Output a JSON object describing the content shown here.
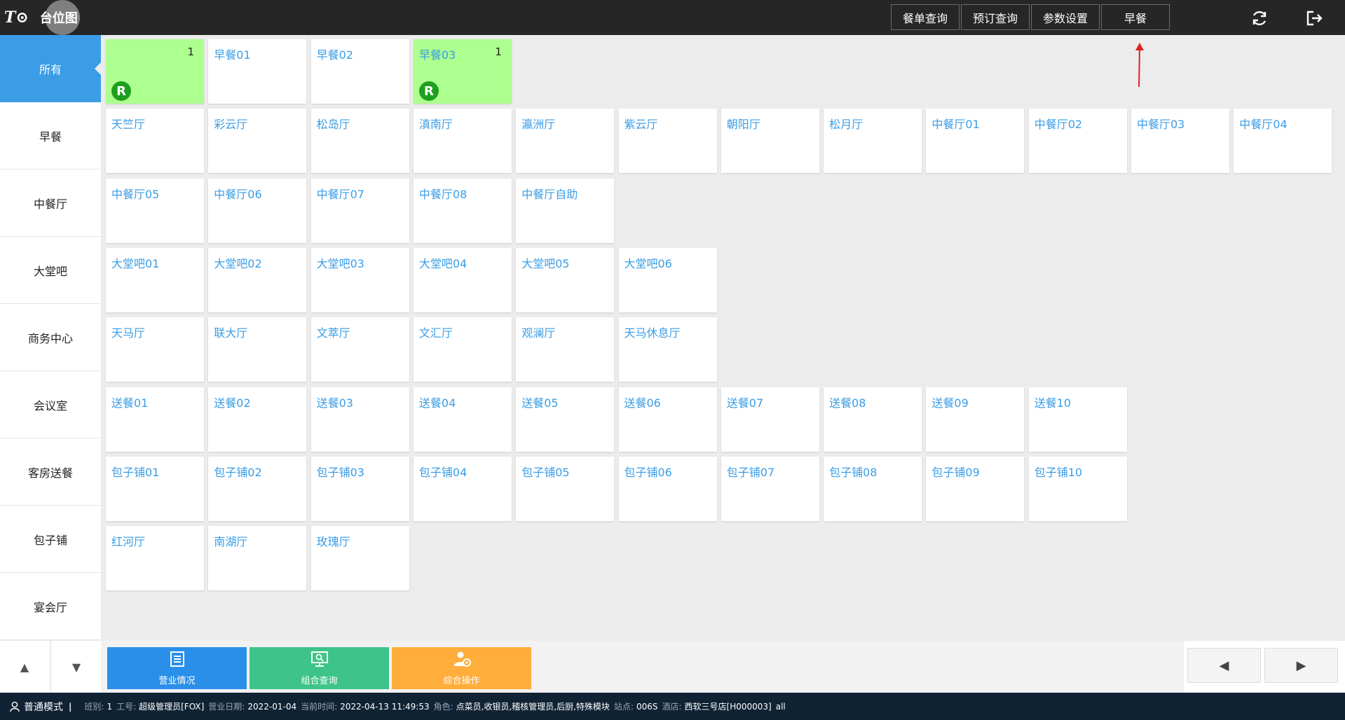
{
  "app": {
    "title": "台位图"
  },
  "header": {
    "buttons": [
      {
        "label": "餐单查询"
      },
      {
        "label": "预订查询"
      },
      {
        "label": "参数设置"
      },
      {
        "label": "早餐"
      }
    ],
    "refresh_icon": "refresh-icon",
    "logout_icon": "logout-icon"
  },
  "sidebar": {
    "items": [
      {
        "label": "所有",
        "active": true
      },
      {
        "label": "早餐"
      },
      {
        "label": "中餐厅"
      },
      {
        "label": "大堂吧"
      },
      {
        "label": "商务中心"
      },
      {
        "label": "会议室"
      },
      {
        "label": "客房送餐"
      },
      {
        "label": "包子铺"
      },
      {
        "label": "宴会厅"
      }
    ]
  },
  "tables": [
    [
      {
        "name": "",
        "occupied": true,
        "count": "1",
        "badge": "R"
      },
      {
        "name": "早餐01"
      },
      {
        "name": "早餐02"
      },
      {
        "name": "早餐03",
        "occupied": true,
        "count": "1",
        "badge": "R"
      }
    ],
    [
      {
        "name": "天竺厅"
      },
      {
        "name": "彩云厅"
      },
      {
        "name": "松岛厅"
      },
      {
        "name": "滇南厅"
      },
      {
        "name": "瀛洲厅"
      },
      {
        "name": "紫云厅"
      },
      {
        "name": "朝阳厅"
      },
      {
        "name": "松月厅"
      },
      {
        "name": "中餐厅01"
      },
      {
        "name": "中餐厅02"
      },
      {
        "name": "中餐厅03"
      },
      {
        "name": "中餐厅04"
      }
    ],
    [
      {
        "name": "中餐厅05"
      },
      {
        "name": "中餐厅06"
      },
      {
        "name": "中餐厅07"
      },
      {
        "name": "中餐厅08"
      },
      {
        "name": "中餐厅自助"
      }
    ],
    [
      {
        "name": "大堂吧01"
      },
      {
        "name": "大堂吧02"
      },
      {
        "name": "大堂吧03"
      },
      {
        "name": "大堂吧04"
      },
      {
        "name": "大堂吧05"
      },
      {
        "name": "大堂吧06"
      }
    ],
    [
      {
        "name": "天马厅"
      },
      {
        "name": "联大厅"
      },
      {
        "name": "文萃厅"
      },
      {
        "name": "文汇厅"
      },
      {
        "name": "观澜厅"
      },
      {
        "name": "天马休息厅"
      }
    ],
    [
      {
        "name": "送餐01"
      },
      {
        "name": "送餐02"
      },
      {
        "name": "送餐03"
      },
      {
        "name": "送餐04"
      },
      {
        "name": "送餐05"
      },
      {
        "name": "送餐06"
      },
      {
        "name": "送餐07"
      },
      {
        "name": "送餐08"
      },
      {
        "name": "送餐09"
      },
      {
        "name": "送餐10"
      }
    ],
    [
      {
        "name": "包子铺01"
      },
      {
        "name": "包子铺02"
      },
      {
        "name": "包子铺03"
      },
      {
        "name": "包子铺04"
      },
      {
        "name": "包子铺05"
      },
      {
        "name": "包子铺06"
      },
      {
        "name": "包子铺07"
      },
      {
        "name": "包子铺08"
      },
      {
        "name": "包子铺09"
      },
      {
        "name": "包子铺10"
      }
    ],
    [
      {
        "name": "红河厅"
      },
      {
        "name": "南湖厅"
      },
      {
        "name": "玫瑰厅"
      }
    ]
  ],
  "actions": [
    {
      "label": "营业情况",
      "color": "#2a8fe8",
      "icon": "document-icon"
    },
    {
      "label": "组合查询",
      "color": "#3ec48a",
      "icon": "monitor-search-icon"
    },
    {
      "label": "综合操作",
      "color": "#ffad3b",
      "icon": "user-gear-icon"
    }
  ],
  "status": {
    "mode": "普通模式",
    "shift_label": "班别:",
    "shift": "1",
    "worker_label": "工号:",
    "worker": "超级管理员[FOX]",
    "bizdate_label": "营业日期:",
    "bizdate": "2022-01-04",
    "time_label": "当前时间:",
    "time": "2022-04-13 11:49:53",
    "role_label": "角色:",
    "role": "点菜员,收银员,稽核管理员,后厨,特殊模块",
    "site_label": "站点:",
    "site": "006S",
    "hotel_label": "酒店:",
    "hotel": "西软三号店[H000003]",
    "hotel_extra": "all"
  },
  "colors": {
    "accent": "#3a9de6",
    "occupied": "#adff8f",
    "badge": "#1ea01e",
    "statusbar": "#102335",
    "annotation_arrow": "#e02020"
  }
}
